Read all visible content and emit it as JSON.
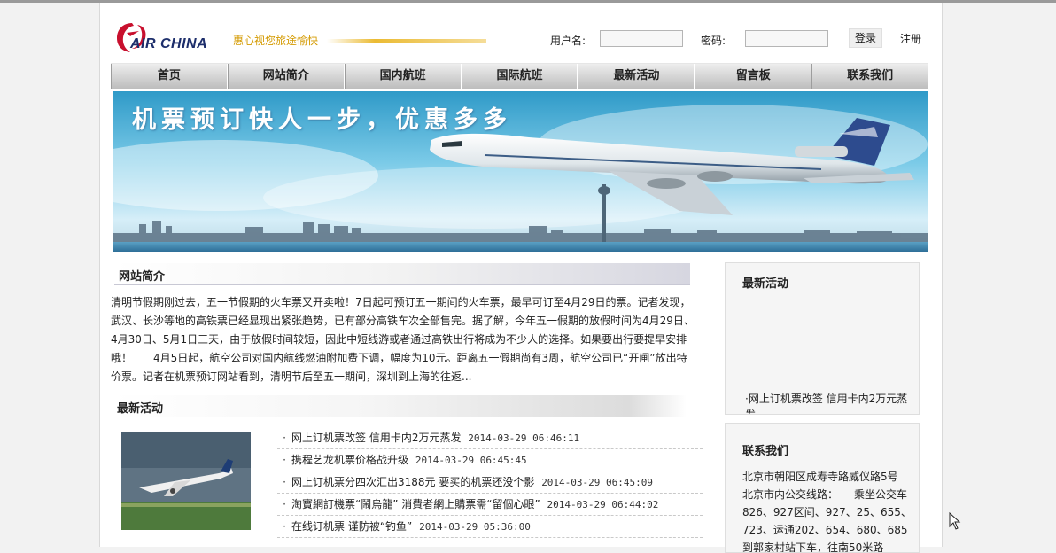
{
  "header": {
    "logo_text": "AIR CHINA",
    "marquee": "惠心视您旅途愉快",
    "username_label": "用户名:",
    "password_label": "密码:",
    "login_button": "登录",
    "register_link": "注册"
  },
  "nav": {
    "items": [
      {
        "label": "首页"
      },
      {
        "label": "网站简介"
      },
      {
        "label": "国内航班"
      },
      {
        "label": "国际航班"
      },
      {
        "label": "最新活动"
      },
      {
        "label": "留言板"
      },
      {
        "label": "联系我们"
      }
    ]
  },
  "banner": {
    "slogan": "机票预订快人一步，优惠多多"
  },
  "intro": {
    "title": "网站简介",
    "text": "清明节假期刚过去，五一节假期的火车票又开卖啦！7日起可预订五一期间的火车票，最早可订至4月29日的票。记者发现，武汉、长沙等地的高铁票已经显现出紧张趋势，已有部分高铁车次全部售完。据了解，今年五一假期的放假时间为4月29日、4月30日、5月1日三天，由于放假时间较短，因此中短线游或者通过高铁出行将成为不少人的选择。如果要出行要提早安排哦！　　4月5日起，航空公司对国内航线燃油附加费下调，幅度为10元。距离五一假期尚有3周，航空公司已“开闸”放出特价票。记者在机票预订网站看到，清明节后至五一期间，深圳到上海的往返..."
  },
  "news": {
    "title": "最新活动",
    "items": [
      {
        "text": "网上订机票改签 信用卡内2万元蒸发",
        "date": "2014-03-29 06:46:11"
      },
      {
        "text": "携程艺龙机票价格战升级",
        "date": "2014-03-29 06:45:45"
      },
      {
        "text": "网上订机票分四次汇出3188元 要买的机票还没个影",
        "date": "2014-03-29 06:45:09"
      },
      {
        "text": "淘寶網訂機票“鬧烏龍” 消費者網上購票需“留個心眼”",
        "date": "2014-03-29 06:44:02"
      },
      {
        "text": "在线订机票 谨防被“钓鱼”",
        "date": "2014-03-29 05:36:00"
      }
    ]
  },
  "sidebar": {
    "activity": {
      "title": "最新活动",
      "item": "·网上订机票改签 信用卡内2万元蒸发"
    },
    "contact": {
      "title": "联系我们",
      "lines": [
        "北京市朝阳区成寿寺路威仪路5号",
        "北京市内公交线路：　　乘坐公交车826、927区间、927、25、655、723、运通202、654、680、685到郭家村站下车，往南50米路"
      ]
    }
  },
  "colors": {
    "brand_red": "#c8102e",
    "brand_blue": "#1d2e6b",
    "marquee_gold": "#d49a00"
  }
}
